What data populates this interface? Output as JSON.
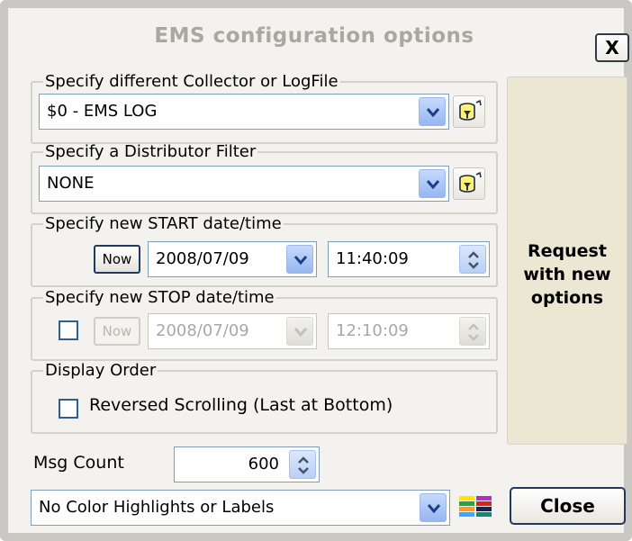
{
  "window": {
    "title": "EMS configuration options",
    "close_label": "X"
  },
  "collector": {
    "legend": "Specify different Collector or LogFile",
    "value": "$0 - EMS LOG"
  },
  "distributor": {
    "legend": "Specify a Distributor Filter",
    "value": "NONE"
  },
  "start": {
    "legend": "Specify new START date/time",
    "now_label": "Now",
    "date": "2008/07/09",
    "time": "11:40:09"
  },
  "stop": {
    "legend": "Specify new STOP date/time",
    "now_label": "Now",
    "date": "2008/07/09",
    "time": "12:10:09",
    "enabled": false
  },
  "display_order": {
    "legend": "Display Order",
    "reversed_label": "Reversed Scrolling (Last at Bottom)",
    "reversed_checked": false
  },
  "msg_count": {
    "label": "Msg Count",
    "value": "600"
  },
  "highlights": {
    "value": "No Color Highlights or Labels"
  },
  "actions": {
    "request_line1": "Request",
    "request_line2": "with new",
    "request_line3": "options",
    "close_label": "Close"
  },
  "colors": {
    "frame": "#c9c8c2",
    "background": "#f3f2ee",
    "request_button": "#ebe7d3",
    "title_text": "#a8a8a0",
    "combo_button": "#95b6f0"
  },
  "icons": {
    "filter": "database-filter-icon",
    "palette": "color-palette-icon",
    "dropdown": "chevron-down-icon",
    "spinner": "up-down-arrows-icon"
  }
}
